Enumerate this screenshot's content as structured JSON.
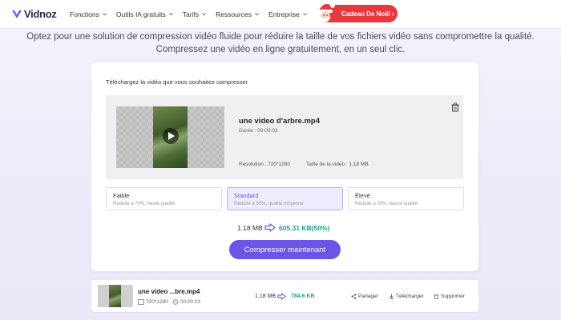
{
  "nav": {
    "logo": "Vidnoz",
    "items": [
      {
        "label": "Fonctions"
      },
      {
        "label": "Outils IA gratuits"
      },
      {
        "label": "Tarifs"
      },
      {
        "label": "Ressources"
      },
      {
        "label": "Entreprise"
      }
    ],
    "promo": "Cadeau De Noël ›"
  },
  "intro": {
    "line1": "Optez pour une solution de compression vidéo fluide pour réduire la taille de vos fichiers vidéo sans compromettre la qualité.",
    "line2": "Compressez une vidéo en ligne gratuitement, en un seul clic."
  },
  "upload": {
    "title": "Téléchargez la vidéo que vous souhaitez compresser",
    "file": {
      "name": "une video d'arbre.mp4",
      "duration": "Durée : 00:00:03",
      "resolution": "Résolution : 720*1280",
      "size": "Taille de la vidéo : 1.18 MB"
    },
    "options": [
      {
        "title": "Faible",
        "desc": "Réduite à 70%, haute qualité"
      },
      {
        "title": "Standard",
        "desc": "Réduite à 50%, qualité moyenne",
        "selected": true
      },
      {
        "title": "Élevé",
        "desc": "Réduite à 30%, basse qualité"
      }
    ],
    "original_size": "1.18 MB",
    "compressed_size": "605.31 KB(50%)",
    "button": "Compresser maintenant"
  },
  "result": {
    "name": "une video ...bre.mp4",
    "resolution": "720*1280",
    "duration": "00:00:03",
    "original_size": "1.18 MB",
    "compressed_size": "784.6 KB",
    "actions": [
      "Partager",
      "Télécharger",
      "Supprimer"
    ]
  },
  "colors": {
    "accent": "#6b55e6",
    "success": "#1aa38e",
    "promo": "#e8383f"
  }
}
